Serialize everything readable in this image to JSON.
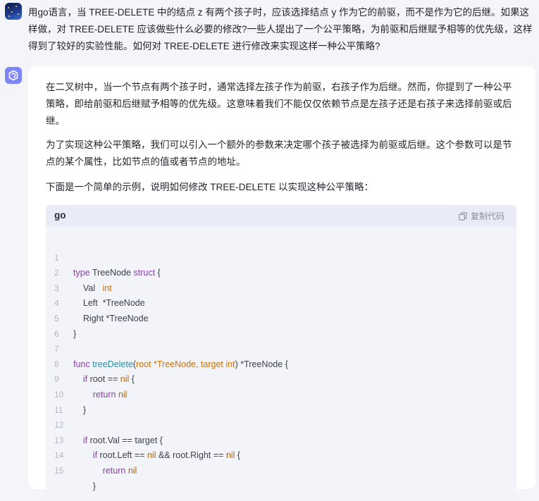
{
  "user": {
    "question": "用go语言，当 TREE-DELETE 中的结点 z 有两个孩子时，应该选择结点 y 作为它的前驱，而不是作为它的后继。如果这样做，对 TREE-DELETE 应该做些什么必要的修改?一些人提出了一个公平策略，为前驱和后继赋予相等的优先级，这样得到了较好的实验性能。如何对 TREE-DELETE 进行修改来实现这样一种公平策略?"
  },
  "answer": {
    "paragraphs": [
      "在二叉树中，当一个节点有两个孩子时，通常选择左孩子作为前驱，右孩子作为后继。然而，你提到了一种公平策略，即给前驱和后继赋予相等的优先级。这意味着我们不能仅仅依赖节点是左孩子还是右孩子来选择前驱或后继。",
      "为了实现这种公平策略，我们可以引入一个额外的参数来决定哪个孩子被选择为前驱或后继。这个参数可以是节点的某个属性，比如节点的值或者节点的地址。",
      "下面是一个简单的示例，说明如何修改 TREE-DELETE 以实现这种公平策略："
    ],
    "code": {
      "language": "go",
      "copy_label": "复制代码",
      "line_numbers": [
        "1",
        "2",
        "3",
        "4",
        "5",
        "6",
        "7",
        "8",
        "9",
        "10",
        "11",
        "12",
        "13",
        "14",
        "15"
      ]
    }
  },
  "colors": {
    "keyword": "#8a3fa8",
    "type": "#c4720a",
    "function": "#2a8aa0",
    "card": "#ffffff",
    "page": "#f4f5f9"
  }
}
